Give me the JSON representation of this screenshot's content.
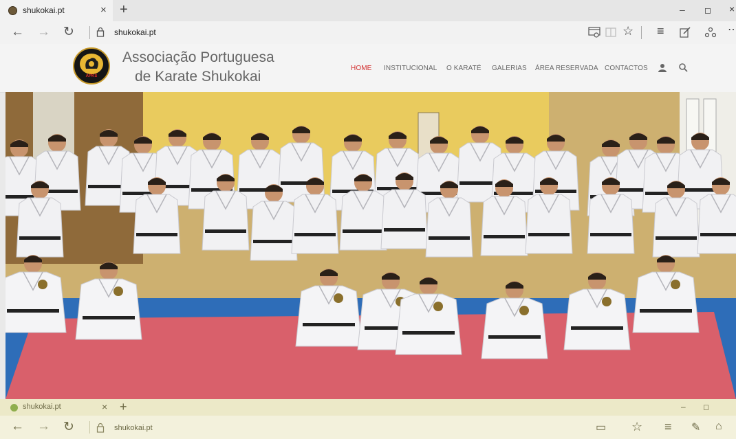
{
  "browser": {
    "tab_title": "shukokai.pt",
    "close_glyph": "×",
    "new_tab_glyph": "+",
    "url": "shukokai.pt",
    "window": {
      "minimize": "–",
      "restore": "◻",
      "close": "×"
    },
    "nav": {
      "back": "←",
      "forward": "→",
      "refresh": "↻"
    },
    "toolbar_icons": [
      "reading-view-icon",
      "favorites-star-icon",
      "hub-icon",
      "web-note-icon",
      "share-icon",
      "more-icon"
    ]
  },
  "site": {
    "brand_line1": "Associação Portuguesa",
    "brand_line2": "de Karate Shukokai",
    "logo_text": "APKS",
    "menu": [
      "HOME",
      "INSTITUCIONAL",
      "O KARATÉ",
      "GALERIAS",
      "ÁREA RESERVADA",
      "CONTACTOS"
    ],
    "active_menu": "HOME",
    "accent_color": "#d32f2f"
  },
  "ghost": {
    "tab_title": "shukokai.pt",
    "url": "shukokai.pt"
  }
}
